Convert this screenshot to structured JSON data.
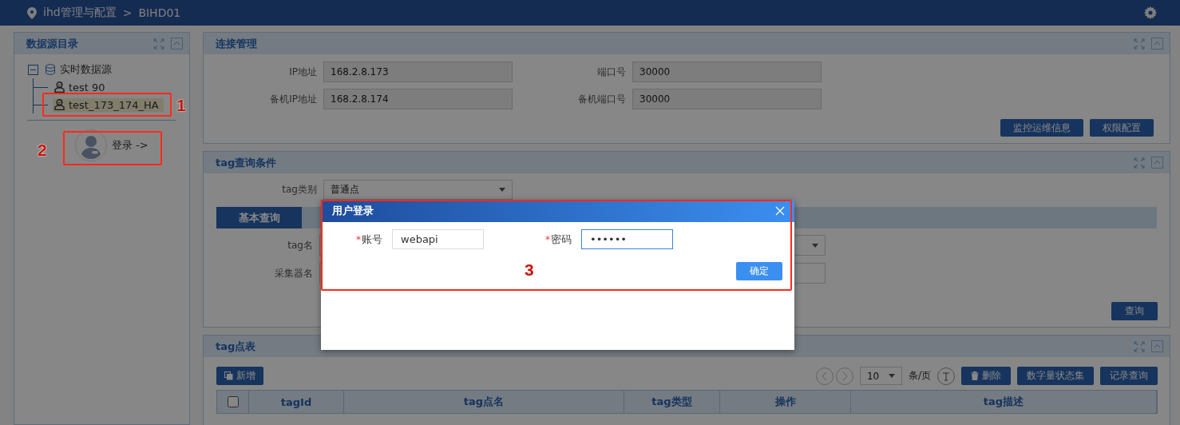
{
  "header": {
    "title": "ihd管理与配置",
    "separator": ">",
    "current": "BIHD01"
  },
  "sidebar": {
    "title": "数据源目录",
    "tree": [
      {
        "label": "实时数据源",
        "expanded": true,
        "children": [
          {
            "label": "test 90",
            "selected": false
          },
          {
            "label": "test_173_174_HA",
            "selected": true
          }
        ]
      }
    ],
    "login": "登录 ->"
  },
  "connection": {
    "title": "连接管理",
    "fields": [
      {
        "label": "IP地址",
        "value": "168.2.8.173"
      },
      {
        "label": "端口号",
        "value": "30000"
      },
      {
        "label": "备机IP地址",
        "value": "168.2.8.174"
      },
      {
        "label": "备机端口号",
        "value": "30000"
      }
    ],
    "buttons": [
      "监控运维信息",
      "权限配置"
    ]
  },
  "query": {
    "title": "tag查询条件",
    "type_label": "tag类别",
    "type_value": "普通点",
    "tabs": [
      {
        "label": "基本查询",
        "selected": true
      }
    ],
    "fields": [
      {
        "label": "tag名",
        "kind": "select"
      },
      {
        "label": "采集器名",
        "kind": "input"
      }
    ],
    "button": "查询"
  },
  "table": {
    "title": "tag点表",
    "add": "新增",
    "page_size": "10",
    "per_page": "条/页",
    "buttons": [
      "删除",
      "数字量状态集",
      "记录查询"
    ],
    "select_all": {
      "checked": false
    },
    "columns": [
      "tagId",
      "tag点名",
      "tag类型",
      "操作",
      "tag描述"
    ]
  },
  "dialog": {
    "title": "用户登录",
    "fields": [
      {
        "marker": "*",
        "label": "账号",
        "value": "webapi",
        "focused": false
      },
      {
        "marker": "*",
        "label": "密码",
        "value": "••••••",
        "focused": true
      }
    ],
    "confirm": "确定"
  },
  "annotations": [
    "1",
    "2",
    "3"
  ]
}
